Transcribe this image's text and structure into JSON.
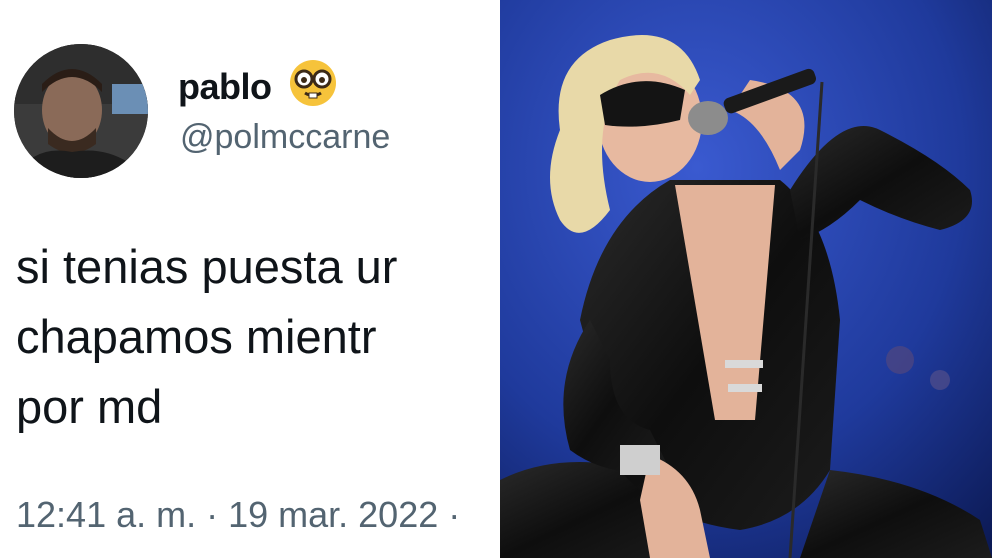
{
  "tweet": {
    "display_name": "pablo",
    "handle": "@polmccarne",
    "text_lines": [
      "si tenias puesta ur",
      "chapamos mientr",
      "por md"
    ],
    "timestamp": "12:41 a. m. · 19 mar. 2022 ·",
    "avatar_icon": "profile-photo",
    "emoji_icon": "nerd-face-emoji"
  },
  "photo": {
    "icon": "concert-performer-photo",
    "colors": {
      "stage_blue": "#1f3a9c",
      "outfit": "#111111",
      "hair": "#e8d9a8",
      "skin": "#e7b9a0"
    }
  }
}
